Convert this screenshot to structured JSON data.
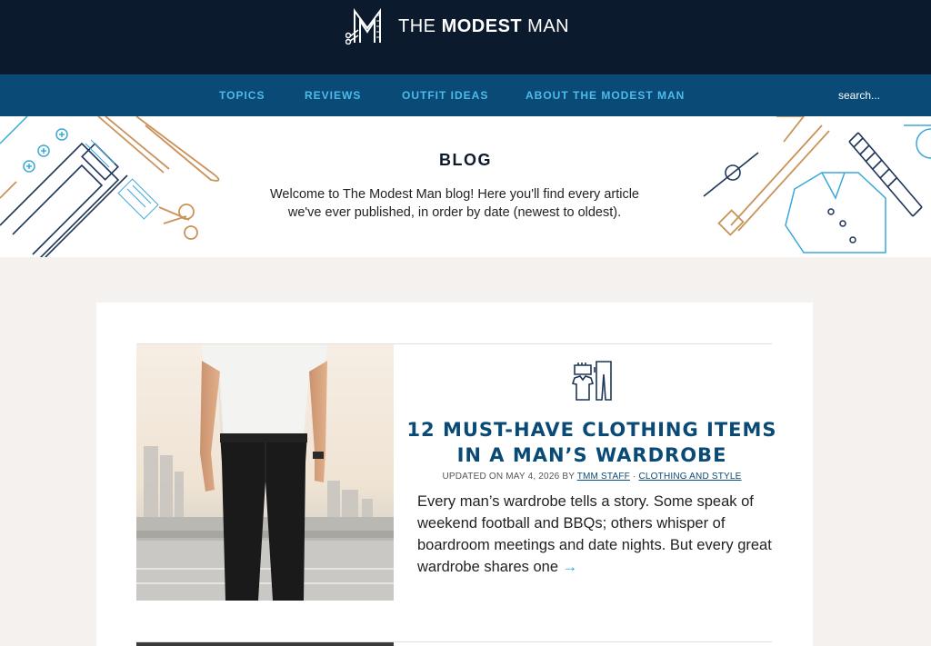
{
  "header": {
    "brand_light1": "THE ",
    "brand_bold": "MODEST",
    "brand_light2": " MAN"
  },
  "nav": {
    "items": [
      "TOPICS",
      "REVIEWS",
      "OUTFIT IDEAS",
      "ABOUT THE MODEST MAN"
    ],
    "search_placeholder": "search..."
  },
  "hero": {
    "title": "BLOG",
    "description": "Welcome to The Modest Man blog! Here you'll find every article we've ever published, in order by date (newest to oldest)."
  },
  "post": {
    "title": "12 MUST-HAVE CLOTHING ITEMS IN A MAN’S WARDROBE",
    "meta_prefix": "UPDATED ON MAY 4, 2026 BY ",
    "author": "TMM STAFF",
    "separator": " · ",
    "category": "CLOTHING AND STYLE",
    "excerpt": "Every man’s wardrobe tells a story. Some speak of weekend football and BBQs; others whisper of boardroom meetings and date nights. But every great wardrobe shares one",
    "read_more_icon": "arrow-right-icon"
  },
  "colors": {
    "header_bg": "#0c1a2e",
    "nav_bg": "#0a4a76",
    "nav_link": "#4dbbe8",
    "title": "#0a4a76",
    "accent": "#2aa7e0",
    "page_bg": "#f4f1ef"
  }
}
